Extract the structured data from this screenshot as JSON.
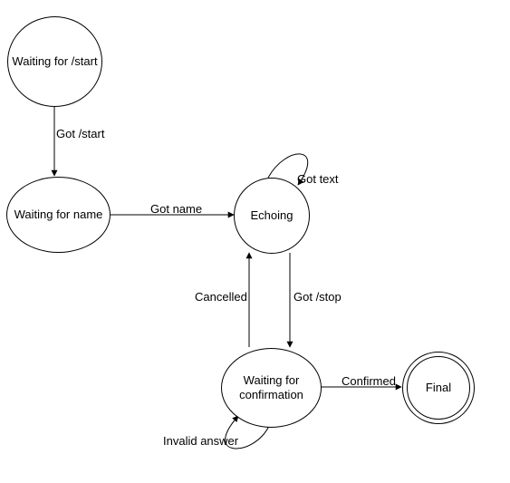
{
  "chart_data": {
    "type": "state_diagram",
    "states": [
      {
        "id": "waiting_start",
        "label": "Waiting for /start",
        "kind": "normal"
      },
      {
        "id": "waiting_name",
        "label": "Waiting for name",
        "kind": "normal"
      },
      {
        "id": "echoing",
        "label": "Echoing",
        "kind": "normal"
      },
      {
        "id": "waiting_conf",
        "label": "Waiting for confirmation",
        "kind": "normal"
      },
      {
        "id": "final",
        "label": "Final",
        "kind": "final"
      }
    ],
    "transitions": [
      {
        "from": "waiting_start",
        "to": "waiting_name",
        "label": "Got /start"
      },
      {
        "from": "waiting_name",
        "to": "echoing",
        "label": "Got name"
      },
      {
        "from": "echoing",
        "to": "echoing",
        "label": "Got text"
      },
      {
        "from": "echoing",
        "to": "waiting_conf",
        "label": "Got /stop"
      },
      {
        "from": "waiting_conf",
        "to": "echoing",
        "label": "Cancelled"
      },
      {
        "from": "waiting_conf",
        "to": "waiting_conf",
        "label": "Invalid answer"
      },
      {
        "from": "waiting_conf",
        "to": "final",
        "label": "Confirmed"
      }
    ]
  }
}
